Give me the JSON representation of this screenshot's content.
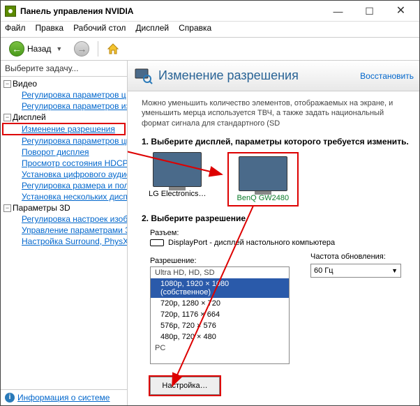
{
  "window": {
    "title": "Панель управления NVIDIA"
  },
  "menu": {
    "file": "Файл",
    "edit": "Правка",
    "desktop": "Рабочий стол",
    "display": "Дисплей",
    "help": "Справка"
  },
  "toolbar": {
    "back": "Назад"
  },
  "sidebar": {
    "heading": "Выберите задачу...",
    "cats": [
      {
        "label": "Видео",
        "items": [
          "Регулировка параметров ц",
          "Регулировка параметров из"
        ]
      },
      {
        "label": "Дисплей",
        "items": [
          "Изменение разрешения",
          "Регулировка параметров цв",
          "Поворот дисплея",
          "Просмотр состояния HDCP",
          "Установка цифрового аудио",
          "Регулировка размера и поло",
          "Установка нескольких дисп"
        ]
      },
      {
        "label": "Параметры 3D",
        "items": [
          "Регулировка настроек изоб",
          "Управление параметрами 3D",
          "Настройка Surround, PhysX"
        ]
      }
    ],
    "sysinfo": "Информация о системе"
  },
  "main": {
    "title": "Изменение разрешения",
    "restore": "Восстановить",
    "description": "Можно уменьшить количество элементов, отображаемых на экране, и уменьшить мерца используется ТВЧ, а также задать национальный формат сигнала для стандартного (SD",
    "step1": "1. Выберите дисплей, параметры которого требуется изменить.",
    "monitors": [
      {
        "name": "LG Electronics…",
        "selected": false
      },
      {
        "name": "BenQ GW2480",
        "selected": true
      }
    ],
    "step2": "2. Выберите разрешение.",
    "connector_label": "Разъем:",
    "connector": "DisplayPort - дисплей настольного компьютера",
    "resolution_label": "Разрешение:",
    "res_groups": [
      {
        "group": "Ultra HD, HD, SD",
        "items": [
          {
            "label": "1080p, 1920 × 1080 (собственное)",
            "selected": true
          },
          {
            "label": "720p, 1280 × 720"
          },
          {
            "label": "720p, 1176 × 664"
          },
          {
            "label": "576p, 720 × 576"
          },
          {
            "label": "480p, 720 × 480"
          }
        ]
      },
      {
        "group": "PC",
        "items": []
      }
    ],
    "refresh_label": "Частота обновления:",
    "refresh_value": "60 Гц",
    "customize": "Настройка…"
  }
}
